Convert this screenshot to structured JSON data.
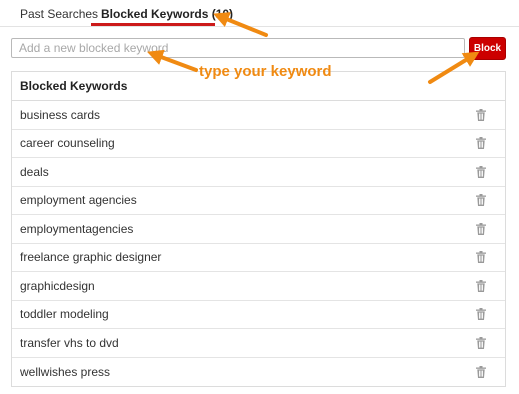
{
  "tabs": {
    "past_searches": "Past Searches",
    "blocked_keywords": "Blocked Keywords (10)"
  },
  "input": {
    "placeholder": "Add a new blocked keyword",
    "value": ""
  },
  "block_button": {
    "label": "Block"
  },
  "annotation": {
    "text": "type your keyword"
  },
  "table": {
    "header": "Blocked Keywords",
    "rows": [
      "business cards",
      "career counseling",
      "deals",
      "employment agencies",
      "employmentagencies",
      "freelance graphic designer",
      "graphicdesign",
      "toddler modeling",
      "transfer vhs to dvd",
      "wellwishes press"
    ]
  },
  "icons": {
    "row_action": "trash-icon",
    "annotation_arrows": "arrow-icon"
  },
  "colors": {
    "accent": "#cc0000",
    "annotation": "#f08a12",
    "tab_underline": "#cc1a1a"
  }
}
